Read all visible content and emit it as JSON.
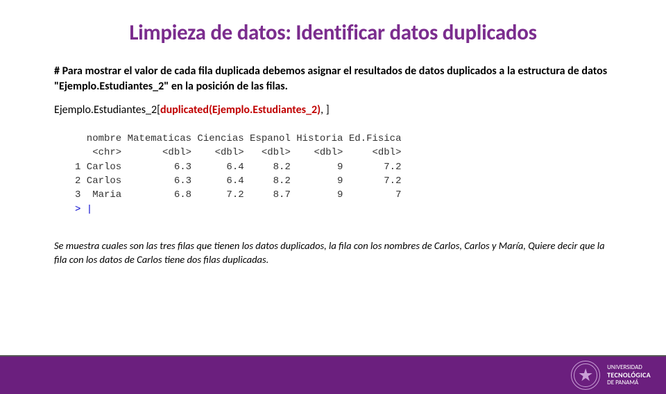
{
  "title": "Limpieza de datos: Identificar datos duplicados",
  "intro": "# Para mostrar el valor de cada fila duplicada debemos asignar el resultados de datos duplicados a la estructura de datos \"Ejemplo.Estudiantes_2\" en la posición de las filas.",
  "code": {
    "prefix": "Ejemplo.Estudiantes_2[",
    "highlight": "duplicated(Ejemplo.Estudiantes_2)",
    "suffix": ", ]"
  },
  "console": {
    "header": "  nombre Matematicas Ciencias Espanol Historia Ed.Fisica",
    "types": "   <chr>       <dbl>    <dbl>   <dbl>    <dbl>     <dbl>",
    "rows": [
      "1 Carlos         6.3      6.4     8.2        9       7.2",
      "2 Carlos         6.3      6.4     8.2        9       7.2",
      "3  Maria         6.8      7.2     8.7        9         7"
    ],
    "prompt": "> |"
  },
  "explanation": "Se muestra cuales son las tres filas que tienen los datos duplicados, la fila con los nombres de Carlos, Carlos y María, Quiere decir que la fila con los datos de Carlos tiene dos filas duplicadas.",
  "footer": {
    "uni_line1": "UNIVERSIDAD",
    "uni_line2": "TECNOLÓGICA",
    "uni_line3": "DE PANAMÁ"
  }
}
